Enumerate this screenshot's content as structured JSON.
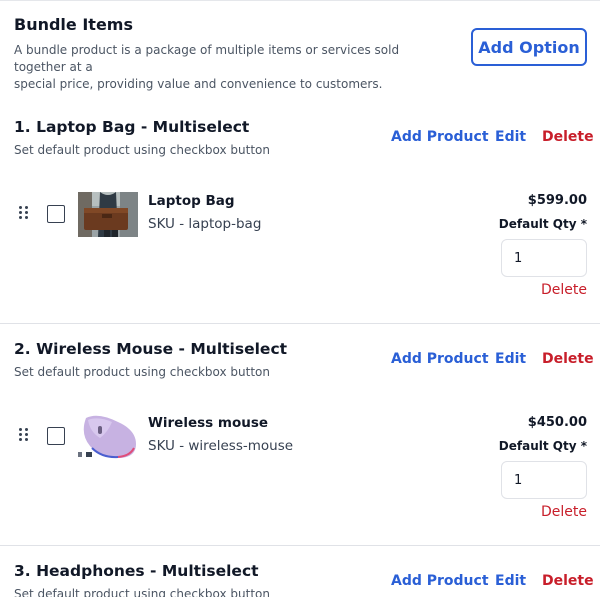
{
  "header": {
    "title": "Bundle Items",
    "description_line1": "A bundle product is a package of multiple items or services sold together at a",
    "description_line2": "special price, providing value and convenience to customers.",
    "add_option_label": "Add Option"
  },
  "actions": {
    "add_product": "Add Product",
    "edit": "Edit",
    "delete": "Delete"
  },
  "options": [
    {
      "title": "1. Laptop Bag - Multiselect",
      "subtitle": "Set default product using checkbox button",
      "product": {
        "name": "Laptop Bag",
        "sku": "SKU - laptop-bag",
        "price": "$599.00",
        "qty_label": "Default Qty *",
        "qty_value": "1",
        "delete_label": "Delete",
        "image_icon": "laptop-bag-photo"
      }
    },
    {
      "title": "2. Wireless Mouse - Multiselect",
      "subtitle": "Set default product using checkbox button",
      "product": {
        "name": "Wireless mouse",
        "sku": "SKU - wireless-mouse",
        "price": "$450.00",
        "qty_label": "Default Qty *",
        "qty_value": "1",
        "delete_label": "Delete",
        "image_icon": "wireless-mouse-photo"
      }
    },
    {
      "title": "3. Headphones - Multiselect",
      "subtitle": "Set default product using checkbox button"
    }
  ],
  "colors": {
    "primary": "#2a5fd6",
    "danger": "#c81e2a",
    "text": "#111827",
    "muted": "#4b5563",
    "border": "#e0e2e7"
  }
}
